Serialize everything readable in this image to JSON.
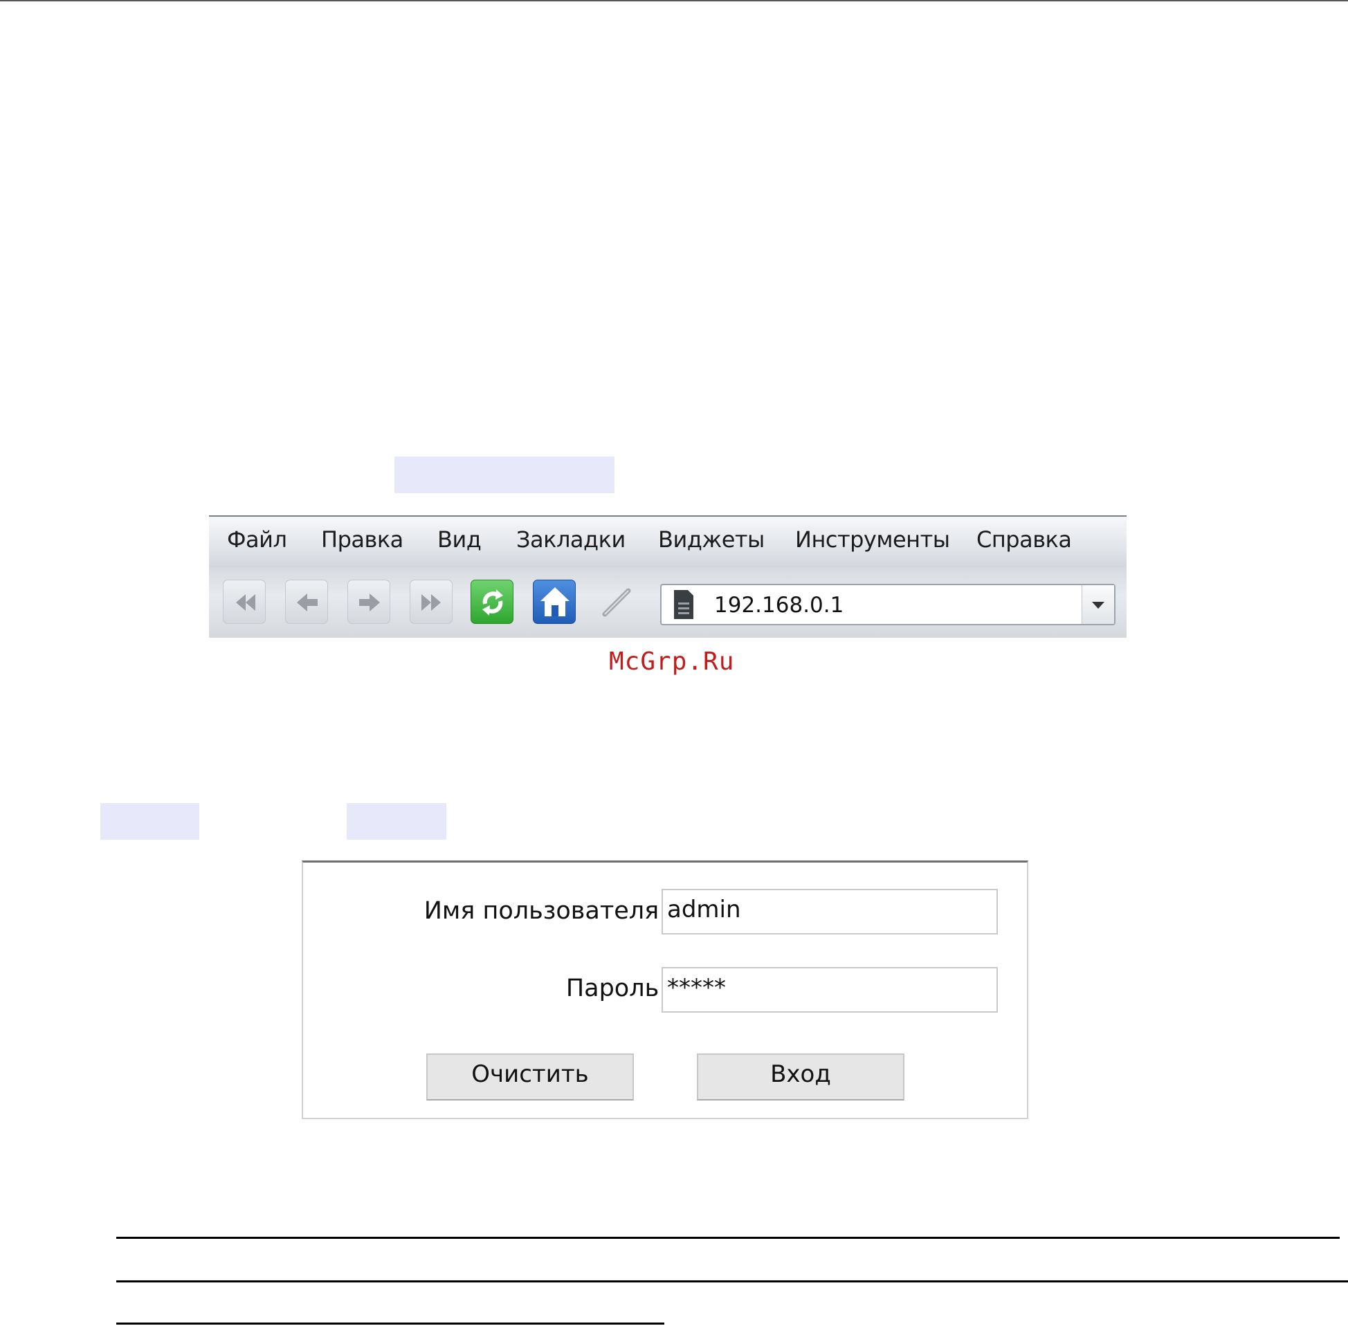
{
  "browser": {
    "menu": [
      "Файл",
      "Правка",
      "Вид",
      "Закладки",
      "Виджеты",
      "Инструменты",
      "Справка"
    ],
    "address": "192.168.0.1",
    "nav_icons": [
      "rewind-icon",
      "back-arrow-icon",
      "forward-arrow-icon",
      "fast-forward-icon",
      "reload-icon",
      "home-icon",
      "edit-icon",
      "page-icon",
      "dropdown-arrow-icon"
    ]
  },
  "watermark": "McGrp.Ru",
  "login": {
    "username_label": "Имя пользователя:",
    "username_value": "admin",
    "password_label": "Пароль:",
    "password_value": "*****",
    "clear_button": "Очистить",
    "login_button": "Вход"
  },
  "colors": {
    "highlight": "#e8e8fb",
    "watermark": "#c21d1d",
    "reload_green": "#2ea62e",
    "home_blue": "#1f5db8"
  }
}
